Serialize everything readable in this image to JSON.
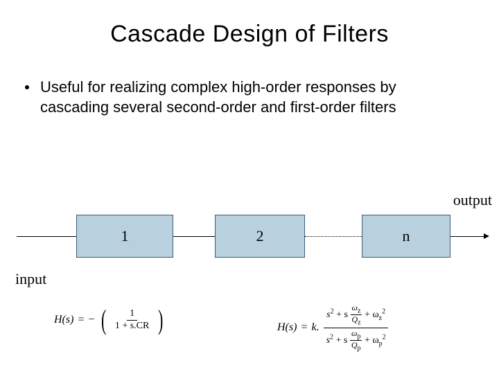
{
  "title": "Cascade Design of Filters",
  "bullet_text": "Useful for realizing complex high-order responses by cascading several second-order and first-order filters",
  "diagram": {
    "input_label": "input",
    "output_label": "output",
    "boxes": {
      "b1": "1",
      "b2": "2",
      "b3": "n"
    }
  },
  "eq1": {
    "lhs": "H(s)",
    "eq": "=",
    "neg": "−",
    "num": "1",
    "den": "1 + s.CR"
  },
  "eq2": {
    "lhs": "H(s)",
    "eq": "=",
    "k": "k.",
    "num_a": "s",
    "num_b": "+ s",
    "num_wz": "ω",
    "num_z": "z",
    "num_Qz": "Q",
    "num_plus": "+ ω",
    "den_wp": "ω",
    "den_p": "p",
    "den_Qp": "Q",
    "sq": "2"
  }
}
